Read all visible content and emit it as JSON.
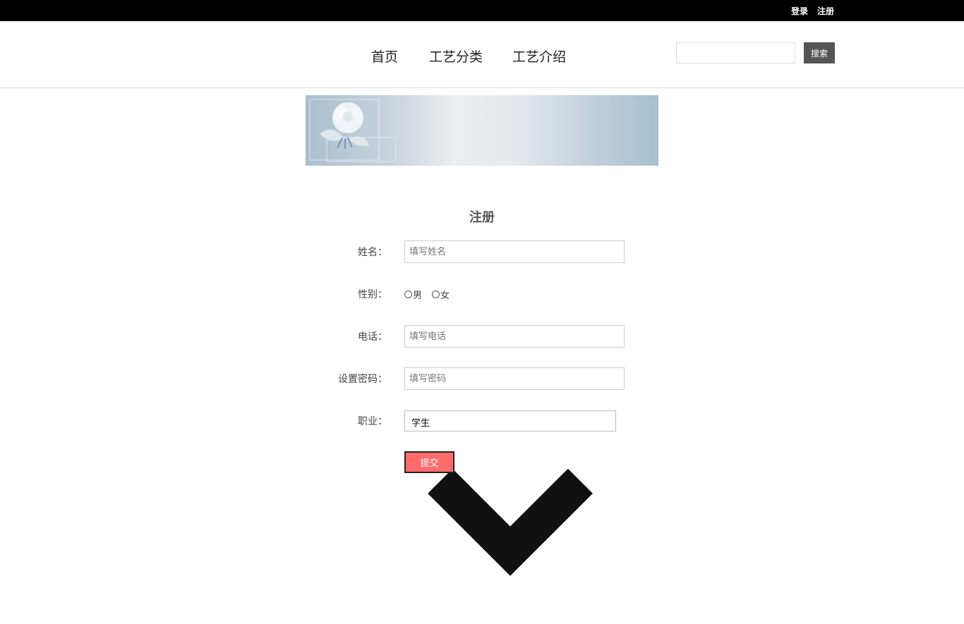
{
  "topbar": {
    "login": "登录",
    "register": "注册"
  },
  "nav": {
    "items": [
      "首页",
      "工艺分类",
      "工艺介绍"
    ]
  },
  "search": {
    "placeholder": "",
    "button": "搜索"
  },
  "form": {
    "title": "注册",
    "name": {
      "label": "姓名：",
      "placeholder": "填写姓名"
    },
    "gender": {
      "label": "性别：",
      "options": [
        "男",
        "女"
      ]
    },
    "phone": {
      "label": "电话：",
      "placeholder": "填写电话"
    },
    "password": {
      "label": "设置密码：",
      "placeholder": "填写密码"
    },
    "occupation": {
      "label": "职业：",
      "selected": "学生"
    },
    "submit": "提交"
  },
  "colors": {
    "topbar": "#000000",
    "search_button": "#555555",
    "submit_button": "#ff6b6b"
  },
  "icons": {
    "banner": "peony-flower-banner",
    "select": "chevron-down-icon",
    "radio": "radio-icon"
  }
}
